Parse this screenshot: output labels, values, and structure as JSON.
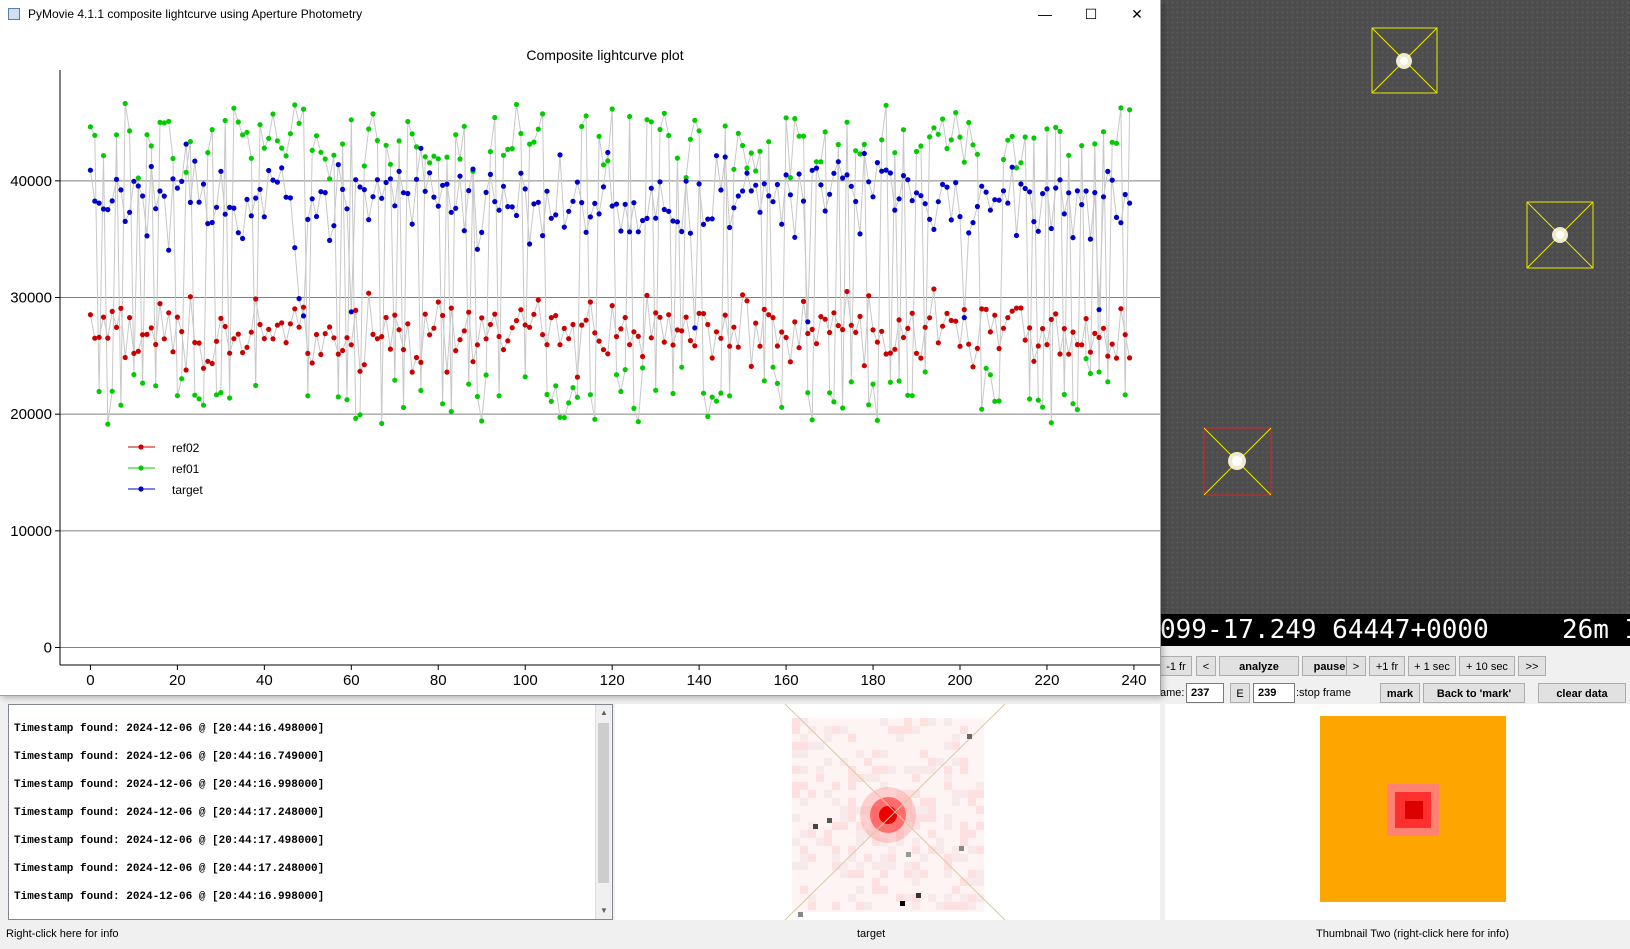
{
  "window": {
    "title": "PyMovie 4.1.1 composite lightcurve using Aperture Photometry",
    "minimize_glyph": "—",
    "maximize_glyph": "☐",
    "close_glyph": "✕"
  },
  "colors": {
    "ref02": "#cc0000",
    "ref01": "#00cc00",
    "target": "#0000cc",
    "connector": "#c8c8c8",
    "aperture_target": "#dd2222",
    "aperture_ref": "#e8e800",
    "thumbnail_two_bg": "#ffa500"
  },
  "chart_data": {
    "type": "scatter",
    "title": "Composite lightcurve plot",
    "xlabel": "",
    "ylabel": "",
    "xlim": [
      -7,
      246
    ],
    "ylim": [
      -1500,
      49500
    ],
    "x_ticks": [
      0,
      20,
      40,
      60,
      80,
      100,
      120,
      140,
      160,
      180,
      200,
      220,
      240
    ],
    "y_ticks": [
      0,
      10000,
      20000,
      30000,
      40000
    ],
    "grid": "horizontal",
    "legend_position": "left-middle",
    "x_start": 0,
    "x_end": 239,
    "series": [
      {
        "name": "ref02",
        "color": "#cc0000",
        "mean": 27000,
        "spread": 2500,
        "min": 23000,
        "max": 31600
      },
      {
        "name": "ref01",
        "color": "#00cc00",
        "low_mean": 21500,
        "high_mean": 43500,
        "min": 18500,
        "max": 47200
      },
      {
        "name": "target",
        "color": "#0000cc",
        "mean": 38500,
        "spread": 4000,
        "min": 23900,
        "max": 44300
      }
    ]
  },
  "video": {
    "timestamp_left": "099-17.249 64447+0000",
    "timestamp_right": "26m I"
  },
  "controls": {
    "minus_one_fr": "-1 fr",
    "back": "<",
    "analyze": "analyze",
    "pause": "pause",
    "forward": ">",
    "plus_one_fr": "+1 fr",
    "plus_one_sec": "+ 1 sec",
    "plus_ten_sec": "+ 10 sec",
    "fast_forward": ">>",
    "frame_label": "ame:",
    "frame_value": "237",
    "end_label": "E",
    "stop_frame_value": "239",
    "stop_frame_label": ":stop frame",
    "mark": "mark",
    "back_to_mark": "Back to 'mark'",
    "clear_data": "clear data"
  },
  "log": {
    "lines": [
      "Timestamp found: 2024-12-06 @ [20:44:16.498000]",
      "Timestamp found: 2024-12-06 @ [20:44:16.749000]",
      "Timestamp found: 2024-12-06 @ [20:44:16.998000]",
      "Timestamp found: 2024-12-06 @ [20:44:17.248000]",
      "Timestamp found: 2024-12-06 @ [20:44:17.498000]",
      "Timestamp found: 2024-12-06 @ [20:44:17.248000]",
      "Timestamp found: 2024-12-06 @ [20:44:16.998000]"
    ],
    "scroll_up": "▲",
    "scroll_down": "▼"
  },
  "captions": {
    "log": "Right-click here for info",
    "thumb1": "target",
    "thumb2": "Thumbnail Two (right-click here for info)"
  }
}
